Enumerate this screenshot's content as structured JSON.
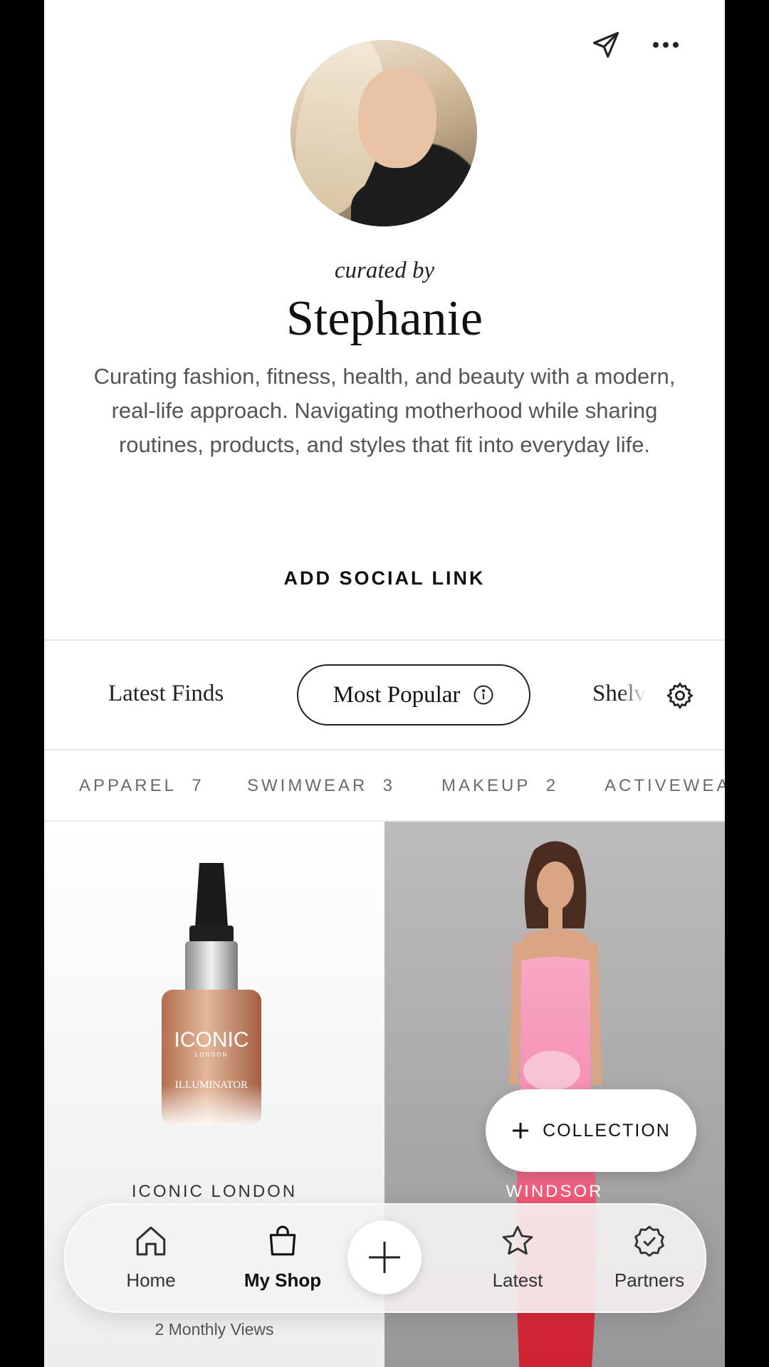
{
  "header": {
    "share_icon": "paper-plane-icon",
    "more_icon": "ellipsis-icon"
  },
  "profile": {
    "curated_by": "curated by",
    "name": "Stephanie",
    "bio": "Curating fashion, fitness, health, and beauty with a modern, real-life approach. Navigating motherhood while sharing routines, products, and styles that fit into everyday life.",
    "add_social_link": "ADD SOCIAL LINK"
  },
  "tabs": {
    "latest": "Latest Finds",
    "popular": "Most Popular",
    "shelves": "Shelves"
  },
  "categories": [
    {
      "label": "APPAREL",
      "count": "7"
    },
    {
      "label": "SWIMWEAR",
      "count": "3"
    },
    {
      "label": "MAKEUP",
      "count": "2"
    },
    {
      "label": "ACTIVEWEAR",
      "count": ""
    }
  ],
  "products": [
    {
      "brand": "ICONIC LONDON",
      "views": "2 Monthly Views",
      "bottle_brand": "ICONIC",
      "bottle_sub": "LONDON",
      "bottle_label": "ILLUMINATOR"
    },
    {
      "brand": "WINDSOR"
    }
  ],
  "fab": {
    "collection": "COLLECTION"
  },
  "nav": {
    "home": "Home",
    "myshop": "My Shop",
    "latest": "Latest",
    "partners": "Partners"
  },
  "colors": {
    "text": "#111111",
    "muted": "#555555",
    "divider": "#e6e6e6"
  }
}
